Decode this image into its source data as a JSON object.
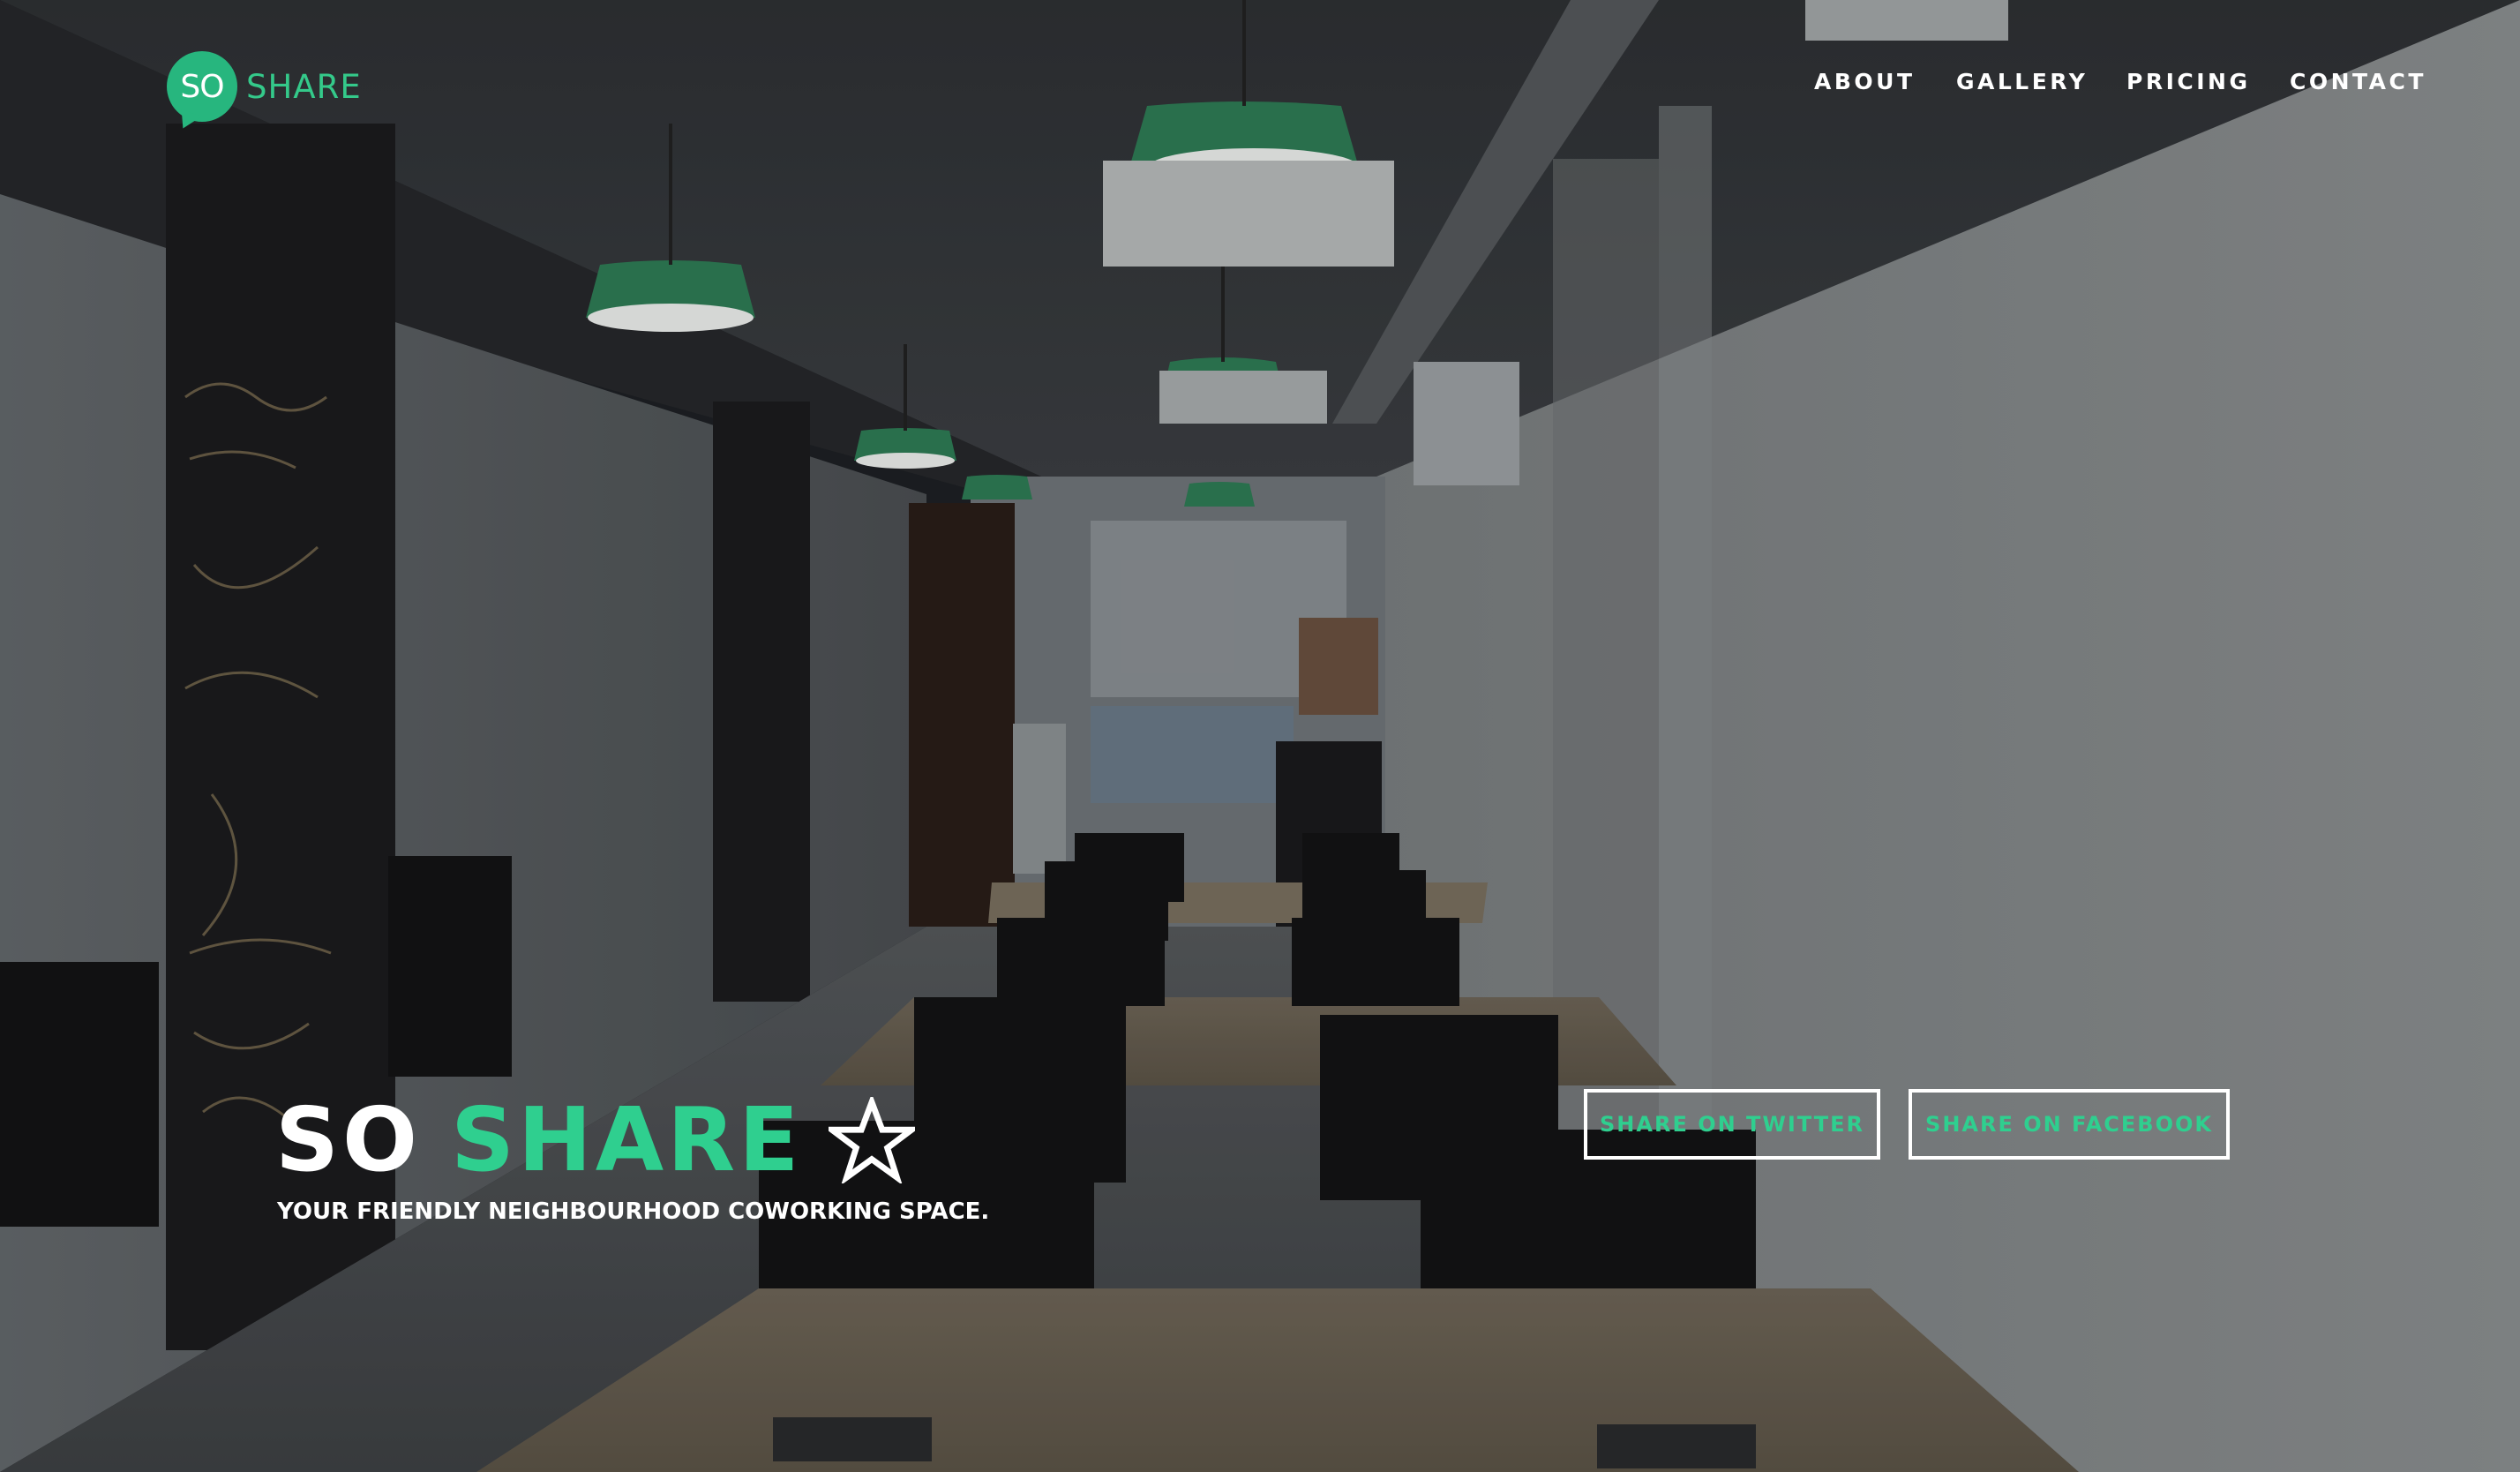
{
  "brand": {
    "logo_mark": "SO",
    "logo_word": "SHARE",
    "accent_color": "#2fcf8f"
  },
  "nav": {
    "items": [
      {
        "label": "ABOUT"
      },
      {
        "label": "GALLERY"
      },
      {
        "label": "PRICING"
      },
      {
        "label": "CONTACT"
      }
    ]
  },
  "hero": {
    "title_part1": "SO",
    "title_part2": "SHARE",
    "title_icon": "star-outline-icon",
    "tagline": "YOUR FRIENDLY NEIGHBOURHOOD COWORKING SPACE.",
    "background": "coworking-office-photo",
    "buttons": {
      "twitter_label": "SHARE ON TWITTER",
      "facebook_label": "SHARE ON FACEBOOK"
    }
  }
}
